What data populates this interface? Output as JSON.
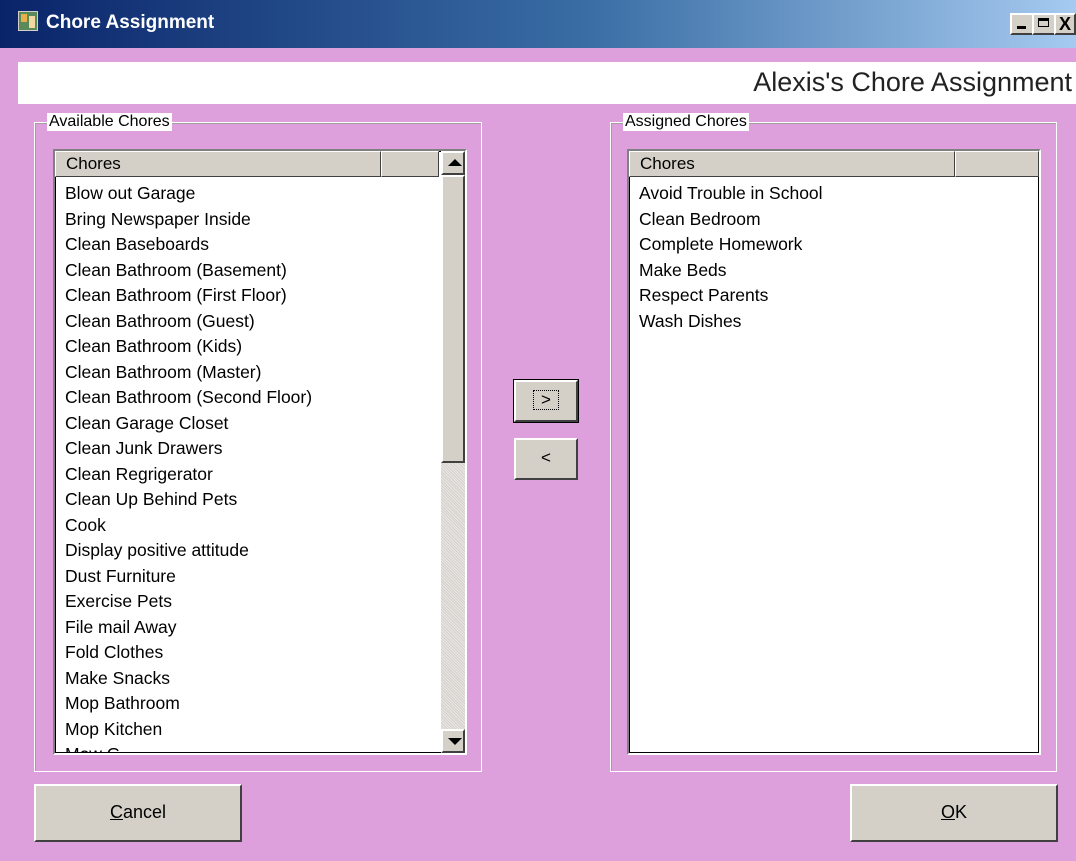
{
  "window": {
    "title": "Chore Assignment",
    "close_glyph": "X",
    "header_title": "Alexis's Chore Assignment"
  },
  "available": {
    "legend": "Available Chores",
    "column": "Chores",
    "items": [
      "Blow out Garage",
      "Bring Newspaper Inside",
      "Clean Baseboards",
      "Clean Bathroom (Basement)",
      "Clean Bathroom (First Floor)",
      "Clean Bathroom (Guest)",
      "Clean Bathroom (Kids)",
      "Clean Bathroom (Master)",
      "Clean Bathroom (Second Floor)",
      "Clean Garage Closet",
      "Clean Junk Drawers",
      "Clean Regrigerator",
      "Clean Up Behind Pets",
      "Cook",
      "Display positive attitude",
      "Dust Furniture",
      "Exercise Pets",
      "File mail Away",
      "Fold Clothes",
      "Make Snacks",
      "Mop Bathroom",
      "Mop Kitchen",
      "Mow G..."
    ]
  },
  "assigned": {
    "legend": "Assigned Chores",
    "column": "Chores",
    "items": [
      "Avoid Trouble in School",
      "Clean Bedroom",
      "Complete Homework",
      "Make Beds",
      "Respect Parents",
      "Wash Dishes"
    ]
  },
  "buttons": {
    "add": ">",
    "remove": "<",
    "cancel_first": "C",
    "cancel_rest": "ancel",
    "ok_first": "O",
    "ok_rest": "K"
  },
  "colors": {
    "background": "#dda0dd",
    "titlebar": "#0a246a",
    "face": "#d4d0c8"
  }
}
